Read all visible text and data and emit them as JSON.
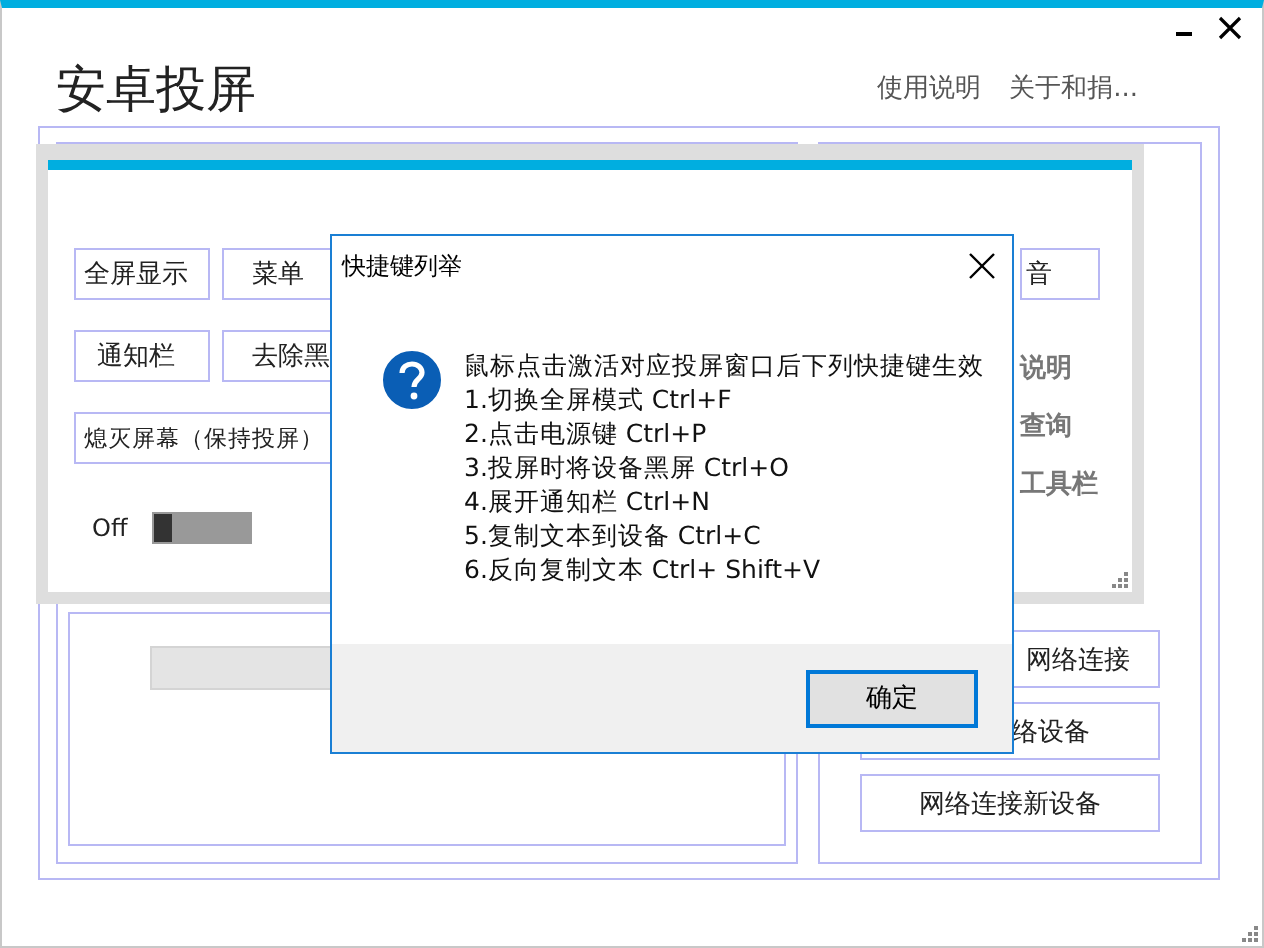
{
  "window": {
    "title": "安卓投屏",
    "menu": [
      {
        "label": "使用说明"
      },
      {
        "label": "关于和捐..."
      }
    ]
  },
  "main_panel": {
    "buttons": [
      {
        "label": "网络连接"
      },
      {
        "label": "络设备"
      },
      {
        "label": "网络连接新设备"
      }
    ]
  },
  "tool_window": {
    "buttons": [
      {
        "label": "全屏显示"
      },
      {
        "label": "菜单"
      },
      {
        "label": "通知栏"
      },
      {
        "label": "去除黑"
      },
      {
        "label": "熄灭屏幕（保持投屏）"
      }
    ],
    "toggle": {
      "label": "Off",
      "on": false
    },
    "right_items": [
      {
        "kind": "button",
        "label": "音"
      },
      {
        "kind": "text",
        "label": "说明"
      },
      {
        "kind": "text",
        "label": "查询"
      },
      {
        "kind": "text",
        "label": "工具栏"
      }
    ]
  },
  "dialog": {
    "title": "快捷键列举",
    "lines": [
      "鼠标点击激活对应投屏窗口后下列快捷键生效",
      "1.切换全屏模式 Ctrl+F",
      "2.点击电源键 Ctrl+P",
      "3.投屏时将设备黑屏 Ctrl+O",
      "4.展开通知栏 Ctrl+N",
      "5.复制文本到设备 Ctrl+C",
      "6.反向复制文本 Ctrl+ Shift+V"
    ],
    "button": "确定"
  }
}
